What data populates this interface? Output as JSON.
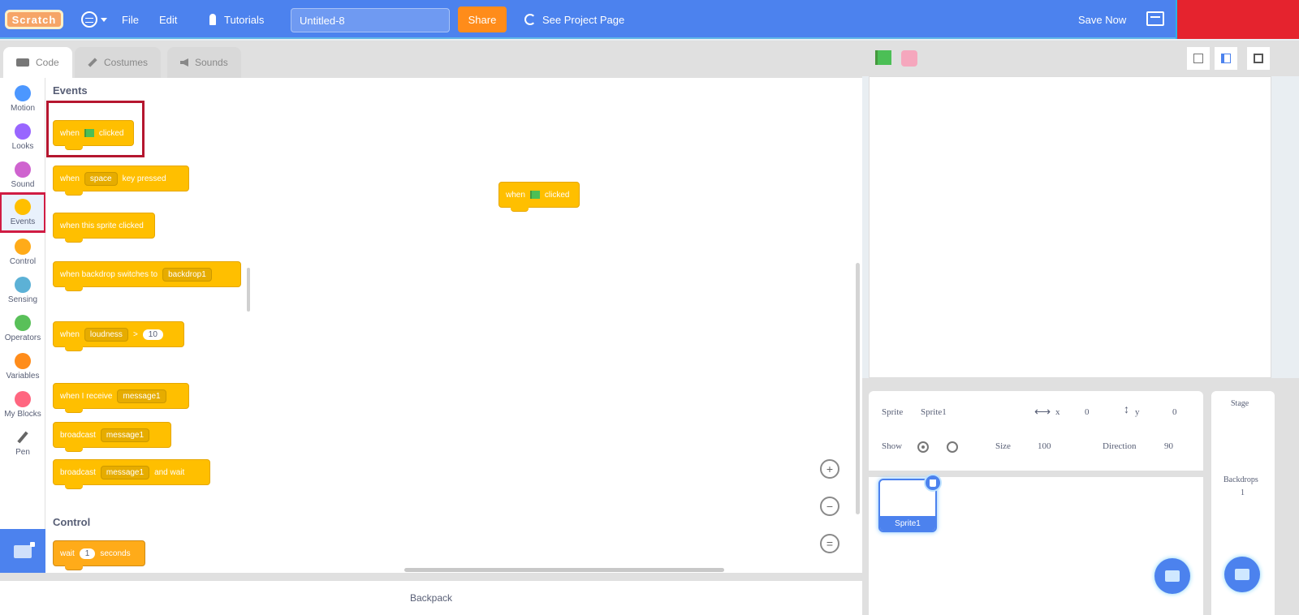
{
  "menubar": {
    "logo": "Scratch",
    "language_icon": "globe-icon",
    "file": "File",
    "edit": "Edit",
    "tutorials": "Tutorials",
    "project_title": "Untitled-8",
    "share": "Share",
    "see_project_page": "See Project Page",
    "save_now": "Save Now",
    "my_stuff_icon": "folder-icon"
  },
  "tabs": [
    {
      "label": "Code",
      "active": true
    },
    {
      "label": "Costumes",
      "active": false
    },
    {
      "label": "Sounds",
      "active": false
    }
  ],
  "categories": [
    {
      "label": "Motion",
      "color": "#4c97ff"
    },
    {
      "label": "Looks",
      "color": "#9966ff"
    },
    {
      "label": "Sound",
      "color": "#cf63cf"
    },
    {
      "label": "Events",
      "color": "#ffbf00",
      "selected": true
    },
    {
      "label": "Control",
      "color": "#ffab19"
    },
    {
      "label": "Sensing",
      "color": "#5cb1d6"
    },
    {
      "label": "Operators",
      "color": "#59c059"
    },
    {
      "label": "Variables",
      "color": "#ff8c1a"
    },
    {
      "label": "My Blocks",
      "color": "#ff6680"
    },
    {
      "label": "Pen",
      "color": "#0fbd8c"
    }
  ],
  "palette": {
    "events_title": "Events",
    "control_title": "Control",
    "blocks": {
      "flag_clicked": {
        "pre": "when",
        "post": "clicked"
      },
      "key_pressed": {
        "pre": "when",
        "key": "space",
        "post": "key pressed"
      },
      "sprite_clicked": {
        "text": "when this sprite clicked"
      },
      "backdrop_switches": {
        "pre": "when backdrop switches to",
        "value": "backdrop1"
      },
      "greater_than": {
        "pre": "when",
        "sensor": "loudness",
        "op": ">",
        "value": "10"
      },
      "receive": {
        "pre": "when I receive",
        "value": "message1"
      },
      "broadcast": {
        "pre": "broadcast",
        "value": "message1"
      },
      "broadcast_wait": {
        "pre": "broadcast",
        "value": "message1",
        "post": "and wait"
      },
      "wait": {
        "pre": "wait",
        "value": "1",
        "post": "seconds"
      }
    }
  },
  "script": {
    "flag_clicked": {
      "pre": "when",
      "post": "clicked"
    }
  },
  "zoom_controls": {
    "zoom_in": "+",
    "zoom_out": "−",
    "reset": "="
  },
  "backpack": "Backpack",
  "sprite_info": {
    "sprite_label": "Sprite",
    "sprite_name": "Sprite1",
    "x_label": "x",
    "x_value": "0",
    "y_label": "y",
    "y_value": "0",
    "show_label": "Show",
    "size_label": "Size",
    "size_value": "100",
    "direction_label": "Direction",
    "direction_value": "90"
  },
  "sprites": [
    {
      "name": "Sprite1",
      "selected": true
    }
  ],
  "stage_pane": {
    "title": "Stage",
    "backdrops_label": "Backdrops",
    "backdrops_count": "1"
  }
}
